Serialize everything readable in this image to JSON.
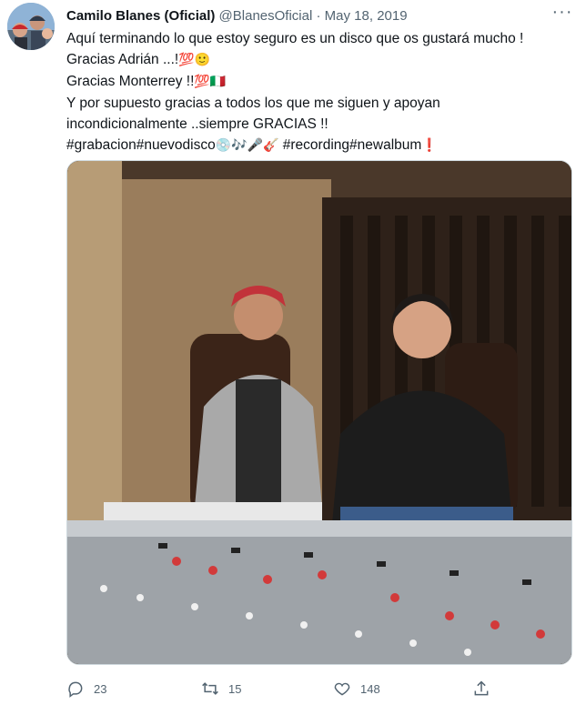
{
  "tweet": {
    "author_name": "Camilo Blanes (Oficial)",
    "handle": "@BlanesOficial",
    "separator": "·",
    "date": "May 18, 2019",
    "more_label": "···",
    "lines": [
      "Aquí terminando lo que estoy seguro es un disco que os gustará mucho !",
      "Gracias Adrián ...!",
      "Gracias Monterrey !!",
      "Y por supuesto gracias a todos los que me siguen y apoyan",
      "incondicionalmente ..siempre GRACIAS !!"
    ],
    "emoji_line2": "💯🙂",
    "emoji_line3": "💯🇮🇹",
    "hashtag_line": {
      "part1": "#grabacion#nuevodisco",
      "emojis": "💿🎶🎤🎸",
      "part2": " #recording#newalbum",
      "end_emoji": "❗"
    }
  },
  "actions": {
    "reply_count": "23",
    "retweet_count": "15",
    "like_count": "148"
  },
  "colors": {
    "text": "#0f1419",
    "secondary": "#536471",
    "border": "#cfd9de"
  }
}
